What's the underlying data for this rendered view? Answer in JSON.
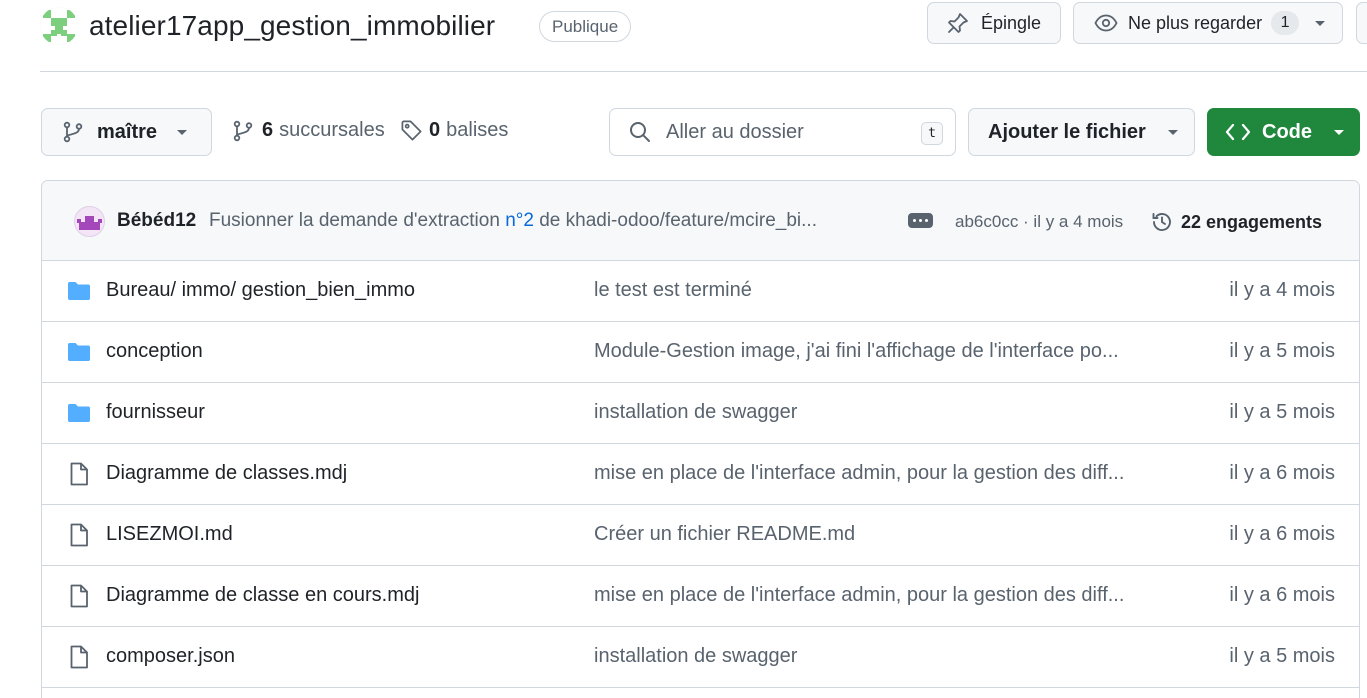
{
  "repo": {
    "name": "atelier17app_gestion_immobilier",
    "visibility": "Publique"
  },
  "header_actions": {
    "pin_label": "Épingle",
    "watch_label": "Ne plus regarder",
    "watch_count": "1"
  },
  "toolbar": {
    "branch": "maître",
    "branches_count": "6",
    "branches_label": "succursales",
    "tags_count": "0",
    "tags_label": "balises",
    "search_placeholder": "Aller au dossier",
    "search_shortcut": "t",
    "add_file_label": "Ajouter le fichier",
    "code_label": "Code"
  },
  "latest_commit": {
    "author": "Bébéd12",
    "message_prefix": "Fusionner la demande d'extraction ",
    "pr_link": "n°2",
    "message_suffix": " de khadi-odoo/feature/mcire_bi...",
    "sha_age": "ab6c0cc · il y a 4 mois",
    "commits_count": "22 engagements"
  },
  "files": [
    {
      "type": "folder",
      "name": "Bureau/ immo/ gestion_bien_immo",
      "message": "le test est terminé",
      "age": "il y a 4 mois"
    },
    {
      "type": "folder",
      "name": "conception",
      "message": "Module-Gestion image, j'ai fini l'affichage de l'interface po...",
      "age": "il y a 5 mois"
    },
    {
      "type": "folder",
      "name": "fournisseur",
      "message": "installation de swagger",
      "age": "il y a 5 mois"
    },
    {
      "type": "file",
      "name": "Diagramme de classes.mdj",
      "message": "mise en place de l'interface admin, pour la gestion des diff...",
      "age": "il y a 6 mois"
    },
    {
      "type": "file",
      "name": "LISEZMOI.md",
      "message": "Créer un fichier README.md",
      "age": "il y a 6 mois"
    },
    {
      "type": "file",
      "name": "Diagramme de classe en cours.mdj",
      "message": "mise en place de l'interface admin, pour la gestion des diff...",
      "age": "il y a 6 mois"
    },
    {
      "type": "file",
      "name": "composer.json",
      "message": "installation de swagger",
      "age": "il y a 5 mois"
    }
  ],
  "colors": {
    "folder": "#54aeff",
    "primary_button": "#1f883d",
    "link": "#0969da"
  }
}
